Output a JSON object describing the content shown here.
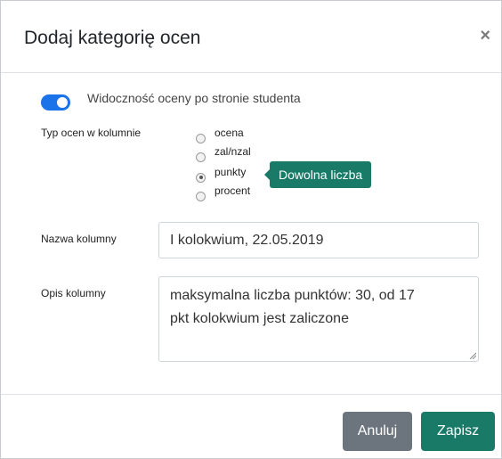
{
  "dialog": {
    "title": "Dodaj kategorię ocen",
    "close_label": "×"
  },
  "visibility_toggle": {
    "label": "Widoczność oceny po stronie studenta",
    "state": "on",
    "accent_color": "#1a73e8"
  },
  "grade_type": {
    "label": "Typ ocen w kolumnie",
    "options": [
      {
        "label": "ocena",
        "checked": false
      },
      {
        "label": "zal/nzal",
        "checked": false
      },
      {
        "label": "punkty",
        "checked": true
      },
      {
        "label": "procent",
        "checked": false
      }
    ],
    "tooltip": "Dowolna liczba"
  },
  "column_name": {
    "label": "Nazwa kolumny",
    "value": "I kolokwium, 22.05.2019"
  },
  "column_description": {
    "label": "Opis kolumny",
    "value_line1": "maksymalna liczba punktów: 30, od 17",
    "value_line2": "pkt kolokwium jest zaliczone"
  },
  "footer": {
    "cancel_label": "Anuluj",
    "save_label": "Zapisz",
    "cancel_color": "#6c757d",
    "save_color": "#1a7a68"
  }
}
